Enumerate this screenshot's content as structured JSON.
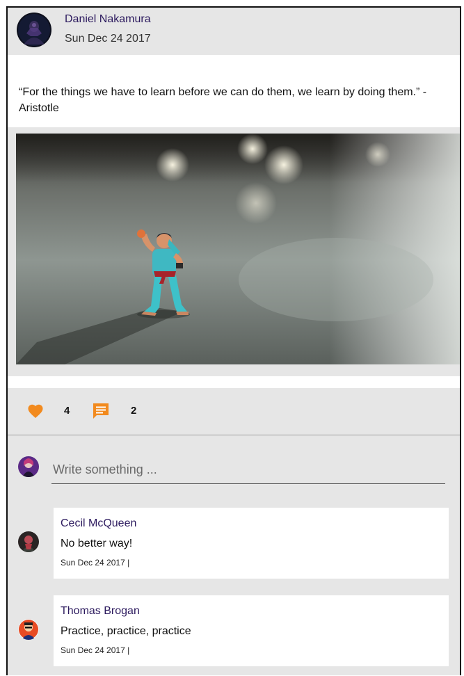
{
  "post": {
    "author": "Daniel Nakamura",
    "date": "Sun Dec 24 2017",
    "text": "“For the things we have to learn before we can do them, we learn by doing them.” - Aristotle",
    "image_alt": "Toy action figure of a martial artist in a fighting stance on a reflective floor",
    "likes": "4",
    "comments": "2"
  },
  "icons": {
    "like": "heart-icon",
    "comment": "comment-icon"
  },
  "colors": {
    "accent": "#f28a1e",
    "name": "#2c1a5e",
    "panel": "#e6e6e6"
  },
  "composer": {
    "placeholder": "Write something ..."
  },
  "comments": [
    {
      "author": "Cecil McQueen",
      "text": "No better way!",
      "date": "Sun Dec 24 2017 |"
    },
    {
      "author": "Thomas Brogan",
      "text": "Practice, practice, practice",
      "date": "Sun Dec 24 2017 |"
    }
  ]
}
